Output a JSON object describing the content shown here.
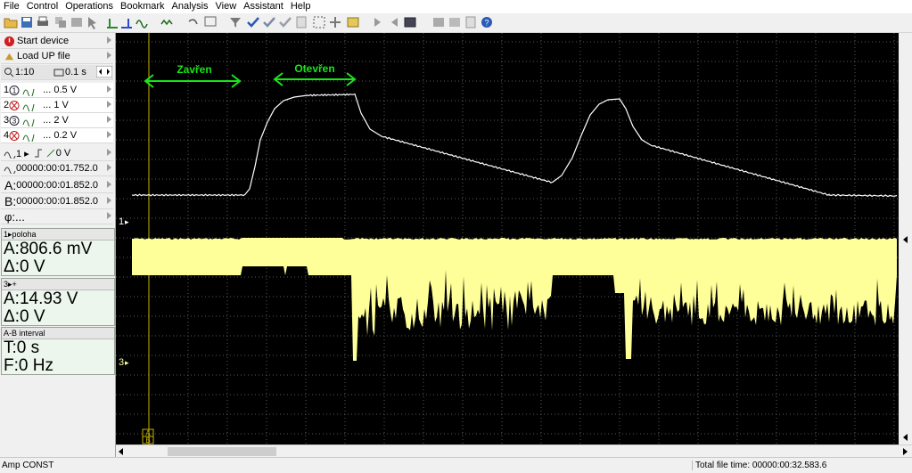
{
  "menu": [
    "File",
    "Control",
    "Operations",
    "Bookmark",
    "Analysis",
    "View",
    "Assistant",
    "Help"
  ],
  "left": {
    "start_device": "Start device",
    "load_file": "Load UP file",
    "zoom": "1:10",
    "timebase": "0.1 s",
    "channels": [
      {
        "num": "1",
        "scale": "... 0.5 V"
      },
      {
        "num": "2",
        "scale": "... 1 V"
      },
      {
        "num": "3",
        "scale": "... 2 V"
      },
      {
        "num": "4",
        "scale": "... 0.2 V"
      }
    ],
    "trigger": "1 ▸",
    "trigger_level": "0 V",
    "time_pos": "00000:00:01.752.0",
    "cursor_a_label": "A:",
    "cursor_a": "00000:00:01.852.0",
    "cursor_b_label": "B:",
    "cursor_b": "00000:00:01.852.0",
    "phi": "φ:..."
  },
  "meas": [
    {
      "title": "1▸poloha",
      "a": "A:806.6 mV",
      "d": "Δ:0 V"
    },
    {
      "title": "3▸+",
      "a": "A:14.93 V",
      "d": "Δ:0 V"
    },
    {
      "title": "A-B interval",
      "a": "T:0 s",
      "d": "F:0 Hz"
    }
  ],
  "scope": {
    "label_closed": "Zavřen",
    "label_open": "Otevřen",
    "ch1_marker": "1",
    "ch3_marker": "3",
    "cursor_a": "A",
    "cursor_b": "B",
    "colors": {
      "trace1": "#ffffff",
      "trace3": "#ffff99",
      "annotation": "#19e619",
      "cursor": "#c8b400",
      "grid": "#5a5a5a"
    }
  },
  "status": {
    "left": "Amp CONST",
    "right": "Total file time: 00000:00:32.583.6"
  }
}
